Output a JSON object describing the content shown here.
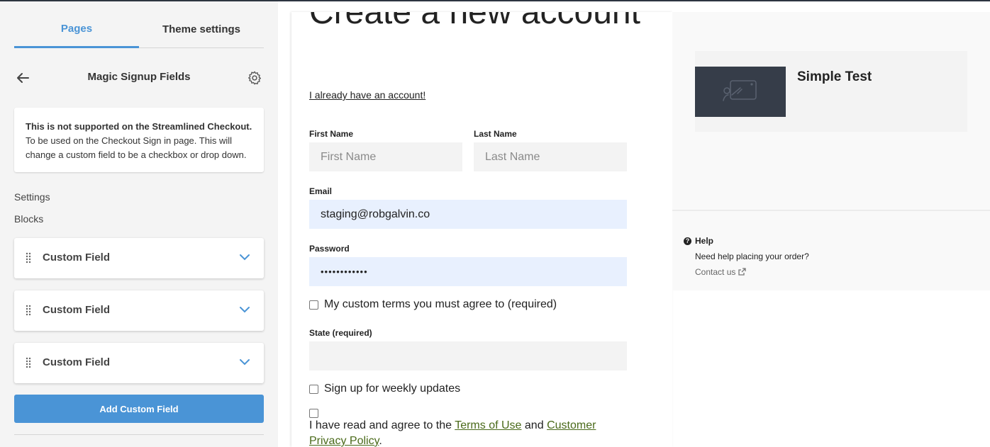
{
  "sidebar": {
    "tabs": [
      {
        "label": "Pages",
        "active": true
      },
      {
        "label": "Theme settings",
        "active": false
      }
    ],
    "back_icon": "arrow-left-icon",
    "title": "Magic Signup Fields",
    "settings_icon": "gear-icon",
    "notice": {
      "bold": "This is not supported on the Streamlined Checkout.",
      "text": "To be used on the Checkout Sign in page. This will change a custom field to be a checkbox or drop down."
    },
    "settings_label": "Settings",
    "blocks_label": "Blocks",
    "blocks": [
      {
        "label": "Custom Field"
      },
      {
        "label": "Custom Field"
      },
      {
        "label": "Custom Field"
      }
    ],
    "add_button": "Add Custom Field",
    "accent_color": "#4a94d6"
  },
  "form": {
    "title": "Create a new account",
    "already_link": "I already have an account!",
    "first_name": {
      "label": "First Name",
      "placeholder": "First Name",
      "value": ""
    },
    "last_name": {
      "label": "Last Name",
      "placeholder": "Last Name",
      "value": ""
    },
    "email": {
      "label": "Email",
      "value": "staging@robgalvin.co"
    },
    "password": {
      "label": "Password",
      "value": "••••••••••••"
    },
    "custom_terms": "My custom terms you must agree to (required)",
    "state": {
      "label": "State (required)",
      "value": ""
    },
    "weekly_updates": "Sign up for weekly updates",
    "terms": {
      "prefix": "I have read and agree to the",
      "terms_link": "Terms of Use",
      "and": "and",
      "privacy_link": "Customer Privacy Policy",
      "suffix": "."
    }
  },
  "summary": {
    "product_name": "Simple Test",
    "product_image_icon": "image-placeholder-icon"
  },
  "help": {
    "title": "Help",
    "text": "Need help placing your order?",
    "link": "Contact us",
    "link_icon": "external-link-icon"
  }
}
